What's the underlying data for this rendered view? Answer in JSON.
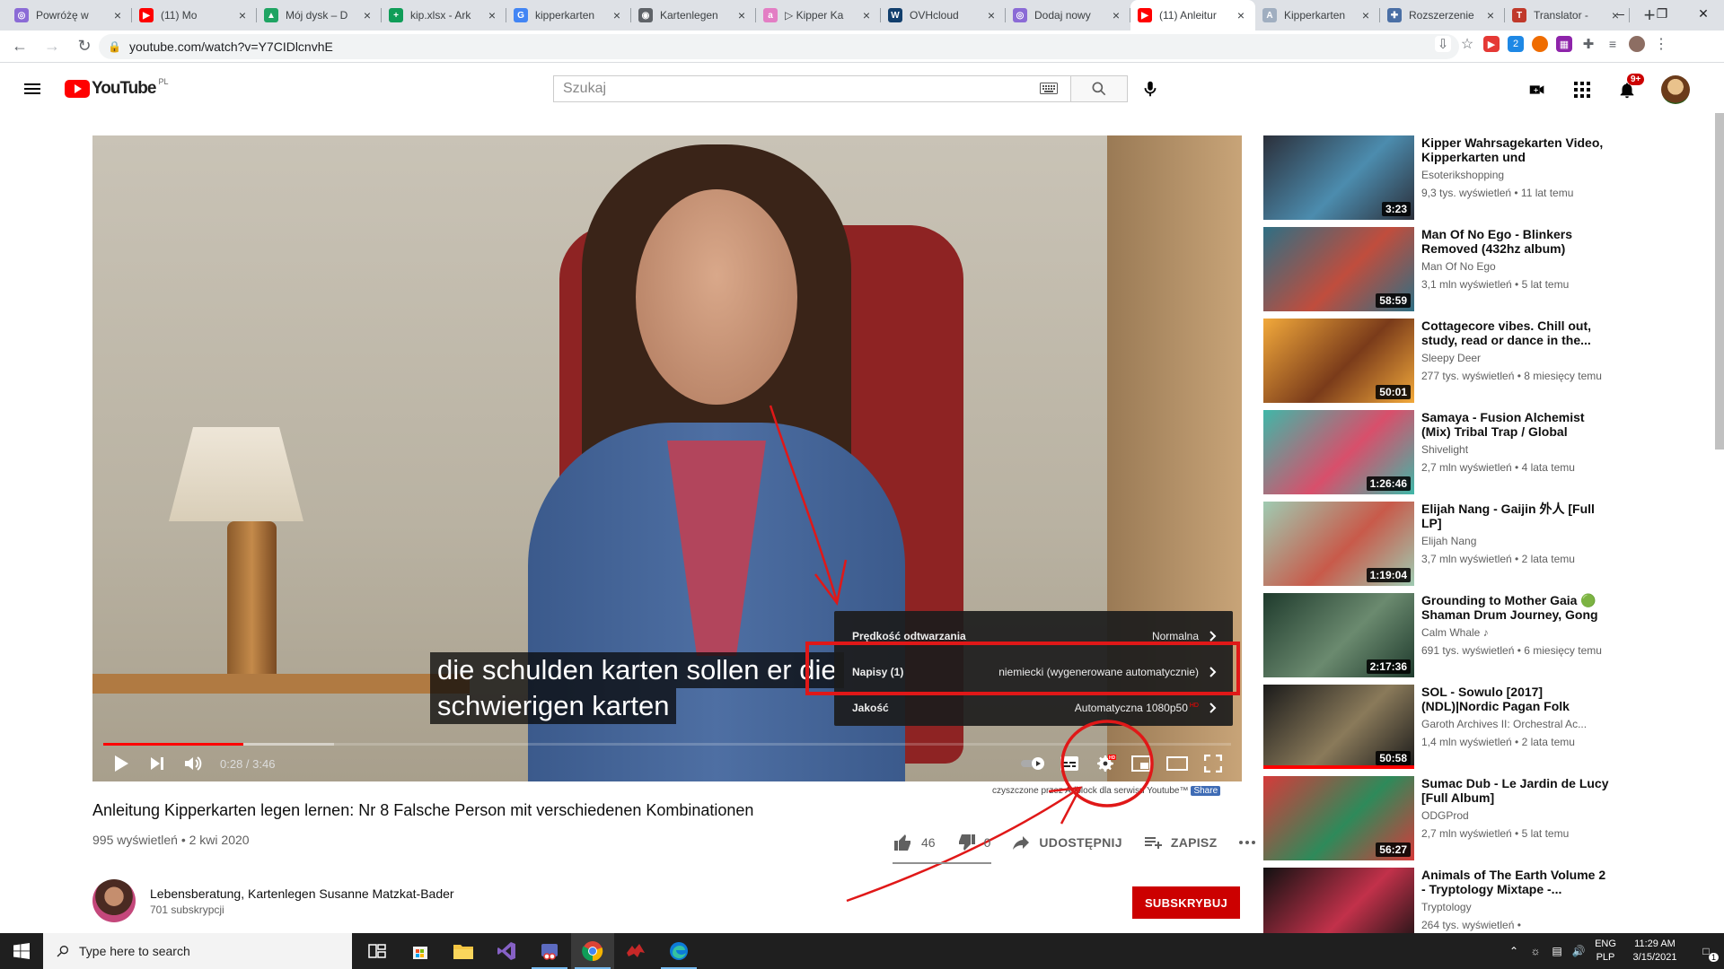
{
  "browser": {
    "tabs": [
      {
        "label": "Powróżę w",
        "color": "#8b6bd6",
        "glyph": "◎"
      },
      {
        "label": "(11) Mo",
        "color": "#ff0000",
        "glyph": "▶"
      },
      {
        "label": "Mój dysk – D",
        "color": "#1fa463",
        "glyph": "▲"
      },
      {
        "label": "kip.xlsx - Ark",
        "color": "#0f9d58",
        "glyph": "+"
      },
      {
        "label": "kipperkarten",
        "color": "#4285f4",
        "glyph": "G"
      },
      {
        "label": "Kartenlegen",
        "color": "#5f6368",
        "glyph": "◉"
      },
      {
        "label": "▷ Kipper Ka",
        "color": "#e37ec4",
        "glyph": "a"
      },
      {
        "label": "OVHcloud",
        "color": "#123f6d",
        "glyph": "W"
      },
      {
        "label": "Dodaj nowy",
        "color": "#8b6bd6",
        "glyph": "◎"
      },
      {
        "label": "(11) Anleitur",
        "color": "#ff0000",
        "glyph": "▶"
      },
      {
        "label": "Kipperkarten",
        "color": "#a0aec0",
        "glyph": "A"
      },
      {
        "label": "Rozszerzenie",
        "color": "#4a6fa5",
        "glyph": "✚"
      },
      {
        "label": "Translator -",
        "color": "#c0392b",
        "glyph": "T"
      }
    ],
    "active_tab": 9,
    "url": "youtube.com/watch?v=Y7CIDlcnvhE"
  },
  "youtube": {
    "region": "PL",
    "search_placeholder": "Szukaj",
    "notif_count": "9+"
  },
  "player": {
    "subtitle_line1": "die schulden karten sollen er die",
    "subtitle_line2": "schwierigen karten",
    "time": "0:28 / 3:46",
    "progress_played": 0.124,
    "progress_loaded": 0.205,
    "settings": [
      {
        "label": "Prędkość odtwarzania",
        "value": "Normalna",
        "hd": ""
      },
      {
        "label": "Napisy (1)",
        "value": "niemiecki (wygenerowane automatycznie)",
        "hd": ""
      },
      {
        "label": "Jakość",
        "value": "Automatyczna 1080p50",
        "hd": "HD"
      }
    ],
    "adblock_note": "czyszczone przez Adblock dla serwisu Youtube™",
    "adblock_share": "Share"
  },
  "video": {
    "title": "Anleitung Kipperkarten legen lernen: Nr 8 Falsche Person mit verschiedenen Kombinationen",
    "meta": "995 wyświetleń • 2 kwi 2020",
    "likes": "46",
    "dislikes": "0",
    "share_label": "UDOSTĘPNIJ",
    "save_label": "ZAPISZ"
  },
  "channel": {
    "name": "Lebensberatung, Kartenlegen Susanne Matzkat-Bader",
    "subs": "701 subskrypcji",
    "subscribe_label": "SUBSKRYBUJ"
  },
  "recommendations": [
    {
      "title": "Kipper Wahrsagekarten Video, Kipperkarten und Kartenlegen...",
      "channel": "Esoterikshopping",
      "views": "9,3 tys. wyświetleń • 11 lat temu",
      "duration": "3:23",
      "c1": "#2b2f3a",
      "c2": "#4c8cae",
      "watched": 0
    },
    {
      "title": "Man Of No Ego - Blinkers Removed (432hz album)",
      "channel": "Man Of No Ego",
      "views": "3,1 mln wyświetleń • 5 lat temu",
      "duration": "58:59",
      "c1": "#2e6f84",
      "c2": "#c04d3d",
      "watched": 0
    },
    {
      "title": "Cottagecore vibes. Chill out, study, read or dance in the...",
      "channel": "Sleepy Deer",
      "views": "277 tys. wyświetleń • 8 miesięcy temu",
      "duration": "50:01",
      "c1": "#f2a93b",
      "c2": "#7a3b1a",
      "watched": 0
    },
    {
      "title": "Samaya - Fusion Alchemist (Mix) Tribal Trap / Global Bass...",
      "channel": "Shivelight",
      "views": "2,7 mln wyświetleń • 4 lata temu",
      "duration": "1:26:46",
      "c1": "#3fb7a8",
      "c2": "#d84f6b",
      "watched": 0
    },
    {
      "title": "Elijah Nang - Gaijin 外人 [Full LP]",
      "channel": "Elijah Nang",
      "views": "3,7 mln wyświetleń • 2 lata temu",
      "duration": "1:19:04",
      "c1": "#9fcbb2",
      "c2": "#c85a4a",
      "watched": 0
    },
    {
      "title": "Grounding to Mother Gaia 🟢 Shaman Drum Journey, Gong ...",
      "channel": "Calm Whale ♪",
      "views": "691 tys. wyświetleń • 6 miesięcy temu",
      "duration": "2:17:36",
      "c1": "#1f3b2d",
      "c2": "#6b8a6f",
      "watched": 0
    },
    {
      "title": "SOL - Sowulo [2017] (NDL)|Nordic Pagan Folk",
      "channel": "Garoth Archives II: Orchestral Ac...",
      "views": "1,4 mln wyświetleń • 2 lata temu",
      "duration": "50:58",
      "c1": "#1a1a1a",
      "c2": "#8a7a5a",
      "watched": 1
    },
    {
      "title": "Sumac Dub - Le Jardin de Lucy [Full Album]",
      "channel": "ODGProd",
      "views": "2,7 mln wyświetleń • 5 lat temu",
      "duration": "56:27",
      "c1": "#d63a3a",
      "c2": "#2e8a5a",
      "watched": 0
    },
    {
      "title": "Animals of The Earth Volume 2 - Tryptology Mixtape -...",
      "channel": "Tryptology",
      "views": "264 tys. wyświetleń •",
      "duration": "",
      "c1": "#111111",
      "c2": "#c2314a",
      "watched": 0
    }
  ],
  "taskbar": {
    "search_placeholder": "Type here to search",
    "lang1": "ENG",
    "lang2": "PLP",
    "time": "11:29 AM",
    "date": "3/15/2021",
    "notif_count": "1"
  }
}
